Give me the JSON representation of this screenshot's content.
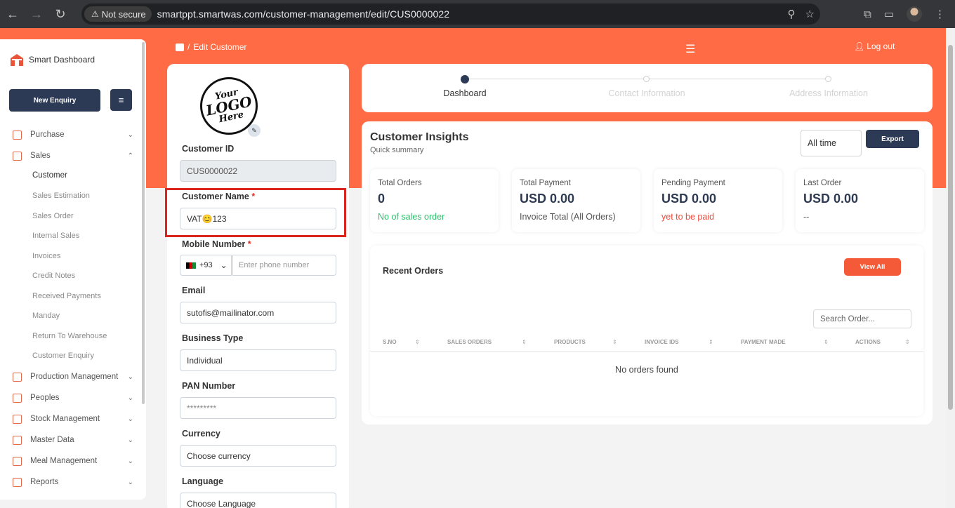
{
  "browser": {
    "security_label": "Not secure",
    "url": "smartppt.smartwas.com/customer-management/edit/CUS0000022"
  },
  "sidebar": {
    "brand": "Smart Dashboard",
    "new_enquiry": "New Enquiry",
    "items": [
      {
        "label": "Purchase"
      },
      {
        "label": "Sales"
      },
      {
        "label": "Production Management"
      },
      {
        "label": "Peoples"
      },
      {
        "label": "Stock Management"
      },
      {
        "label": "Master Data"
      },
      {
        "label": "Meal Management"
      },
      {
        "label": "Reports"
      }
    ],
    "sales_sub": [
      "Customer",
      "Sales Estimation",
      "Sales Order",
      "Internal Sales",
      "Invoices",
      "Credit Notes",
      "Received Payments",
      "Manday",
      "Return To Warehouse",
      "Customer Enquiry"
    ]
  },
  "topbar": {
    "separator": "/",
    "breadcrumb": "Edit Customer",
    "logout": "Log out"
  },
  "form": {
    "logo_text": [
      "Your",
      "LOGO",
      "Here"
    ],
    "customer_id_label": "Customer ID",
    "customer_id": "CUS0000022",
    "customer_name_label": "Customer Name",
    "customer_name": "VAT😊123",
    "mobile_label": "Mobile Number",
    "phone_code": "+93",
    "phone_placeholder": "Enter phone number",
    "email_label": "Email",
    "email": "sutofis@mailinator.com",
    "business_type_label": "Business Type",
    "business_type": "Individual",
    "pan_label": "PAN Number",
    "pan": "*********",
    "currency_label": "Currency",
    "currency": "Choose currency",
    "language_label": "Language",
    "language": "Choose Language",
    "required_mark": "*"
  },
  "stepper": {
    "steps": [
      "Dashboard",
      "Contact Information",
      "Address Information"
    ],
    "active_index": 0
  },
  "insights": {
    "title": "Customer Insights",
    "subtitle": "Quick summary",
    "time_filter": "All time",
    "export": "Export",
    "cards": [
      {
        "title": "Total Orders",
        "value": "0",
        "note": "No of sales order"
      },
      {
        "title": "Total Payment",
        "value": "USD 0.00",
        "note": "Invoice Total (All Orders)"
      },
      {
        "title": "Pending Payment",
        "value": "USD 0.00",
        "note": "yet to be paid"
      },
      {
        "title": "Last Order",
        "value": "USD 0.00",
        "note": "--"
      }
    ],
    "recent_orders": {
      "title": "Recent Orders",
      "view_all": "View All",
      "search_placeholder": "Search Order...",
      "columns": [
        "S.NO",
        "SALES ORDERS",
        "PRODUCTS",
        "INVOICE IDS",
        "PAYMENT MADE",
        "ACTIONS"
      ],
      "empty": "No orders found"
    }
  },
  "colors": {
    "accent": "#ff6b45",
    "navy": "#2d3a56",
    "green": "#2bbf6a",
    "red": "#f04a3a"
  }
}
